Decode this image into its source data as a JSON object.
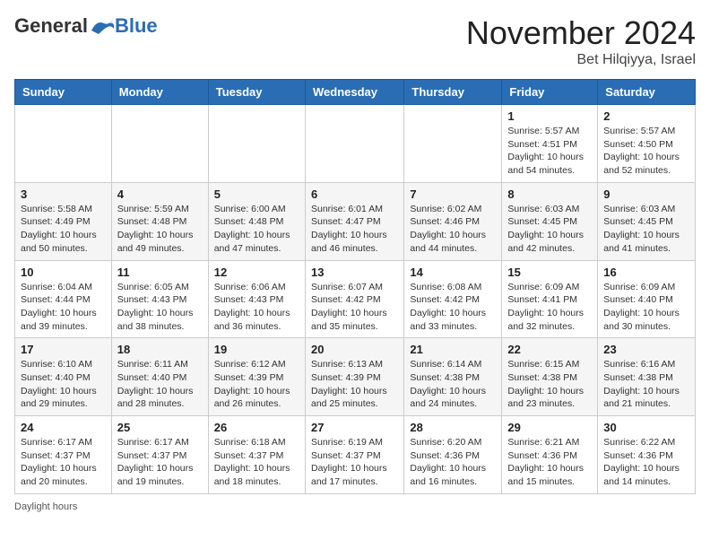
{
  "logo": {
    "general": "General",
    "blue": "Blue"
  },
  "title": "November 2024",
  "subtitle": "Bet Hilqiyya, Israel",
  "days_of_week": [
    "Sunday",
    "Monday",
    "Tuesday",
    "Wednesday",
    "Thursday",
    "Friday",
    "Saturday"
  ],
  "weeks": [
    [
      {
        "day": "",
        "info": ""
      },
      {
        "day": "",
        "info": ""
      },
      {
        "day": "",
        "info": ""
      },
      {
        "day": "",
        "info": ""
      },
      {
        "day": "",
        "info": ""
      },
      {
        "day": "1",
        "info": "Sunrise: 5:57 AM\nSunset: 4:51 PM\nDaylight: 10 hours\nand 54 minutes."
      },
      {
        "day": "2",
        "info": "Sunrise: 5:57 AM\nSunset: 4:50 PM\nDaylight: 10 hours\nand 52 minutes."
      }
    ],
    [
      {
        "day": "3",
        "info": "Sunrise: 5:58 AM\nSunset: 4:49 PM\nDaylight: 10 hours\nand 50 minutes."
      },
      {
        "day": "4",
        "info": "Sunrise: 5:59 AM\nSunset: 4:48 PM\nDaylight: 10 hours\nand 49 minutes."
      },
      {
        "day": "5",
        "info": "Sunrise: 6:00 AM\nSunset: 4:48 PM\nDaylight: 10 hours\nand 47 minutes."
      },
      {
        "day": "6",
        "info": "Sunrise: 6:01 AM\nSunset: 4:47 PM\nDaylight: 10 hours\nand 46 minutes."
      },
      {
        "day": "7",
        "info": "Sunrise: 6:02 AM\nSunset: 4:46 PM\nDaylight: 10 hours\nand 44 minutes."
      },
      {
        "day": "8",
        "info": "Sunrise: 6:03 AM\nSunset: 4:45 PM\nDaylight: 10 hours\nand 42 minutes."
      },
      {
        "day": "9",
        "info": "Sunrise: 6:03 AM\nSunset: 4:45 PM\nDaylight: 10 hours\nand 41 minutes."
      }
    ],
    [
      {
        "day": "10",
        "info": "Sunrise: 6:04 AM\nSunset: 4:44 PM\nDaylight: 10 hours\nand 39 minutes."
      },
      {
        "day": "11",
        "info": "Sunrise: 6:05 AM\nSunset: 4:43 PM\nDaylight: 10 hours\nand 38 minutes."
      },
      {
        "day": "12",
        "info": "Sunrise: 6:06 AM\nSunset: 4:43 PM\nDaylight: 10 hours\nand 36 minutes."
      },
      {
        "day": "13",
        "info": "Sunrise: 6:07 AM\nSunset: 4:42 PM\nDaylight: 10 hours\nand 35 minutes."
      },
      {
        "day": "14",
        "info": "Sunrise: 6:08 AM\nSunset: 4:42 PM\nDaylight: 10 hours\nand 33 minutes."
      },
      {
        "day": "15",
        "info": "Sunrise: 6:09 AM\nSunset: 4:41 PM\nDaylight: 10 hours\nand 32 minutes."
      },
      {
        "day": "16",
        "info": "Sunrise: 6:09 AM\nSunset: 4:40 PM\nDaylight: 10 hours\nand 30 minutes."
      }
    ],
    [
      {
        "day": "17",
        "info": "Sunrise: 6:10 AM\nSunset: 4:40 PM\nDaylight: 10 hours\nand 29 minutes."
      },
      {
        "day": "18",
        "info": "Sunrise: 6:11 AM\nSunset: 4:40 PM\nDaylight: 10 hours\nand 28 minutes."
      },
      {
        "day": "19",
        "info": "Sunrise: 6:12 AM\nSunset: 4:39 PM\nDaylight: 10 hours\nand 26 minutes."
      },
      {
        "day": "20",
        "info": "Sunrise: 6:13 AM\nSunset: 4:39 PM\nDaylight: 10 hours\nand 25 minutes."
      },
      {
        "day": "21",
        "info": "Sunrise: 6:14 AM\nSunset: 4:38 PM\nDaylight: 10 hours\nand 24 minutes."
      },
      {
        "day": "22",
        "info": "Sunrise: 6:15 AM\nSunset: 4:38 PM\nDaylight: 10 hours\nand 23 minutes."
      },
      {
        "day": "23",
        "info": "Sunrise: 6:16 AM\nSunset: 4:38 PM\nDaylight: 10 hours\nand 21 minutes."
      }
    ],
    [
      {
        "day": "24",
        "info": "Sunrise: 6:17 AM\nSunset: 4:37 PM\nDaylight: 10 hours\nand 20 minutes."
      },
      {
        "day": "25",
        "info": "Sunrise: 6:17 AM\nSunset: 4:37 PM\nDaylight: 10 hours\nand 19 minutes."
      },
      {
        "day": "26",
        "info": "Sunrise: 6:18 AM\nSunset: 4:37 PM\nDaylight: 10 hours\nand 18 minutes."
      },
      {
        "day": "27",
        "info": "Sunrise: 6:19 AM\nSunset: 4:37 PM\nDaylight: 10 hours\nand 17 minutes."
      },
      {
        "day": "28",
        "info": "Sunrise: 6:20 AM\nSunset: 4:36 PM\nDaylight: 10 hours\nand 16 minutes."
      },
      {
        "day": "29",
        "info": "Sunrise: 6:21 AM\nSunset: 4:36 PM\nDaylight: 10 hours\nand 15 minutes."
      },
      {
        "day": "30",
        "info": "Sunrise: 6:22 AM\nSunset: 4:36 PM\nDaylight: 10 hours\nand 14 minutes."
      }
    ]
  ],
  "footer": "Daylight hours"
}
